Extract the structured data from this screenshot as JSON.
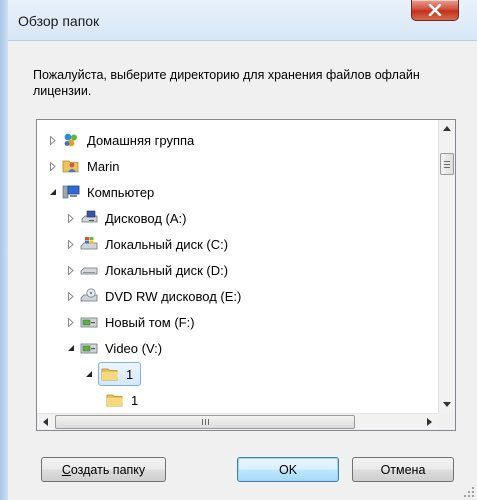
{
  "window": {
    "title": "Обзор папок",
    "instruction": "Пожалуйста, выберите директорию для хранения файлов офлайн лицензии."
  },
  "tree": {
    "items": [
      {
        "label": "Домашняя группа",
        "icon": "homegroup-icon",
        "expanded": false
      },
      {
        "label": "Marin",
        "icon": "user-folder-icon",
        "expanded": false
      },
      {
        "label": "Компьютер",
        "icon": "computer-icon",
        "expanded": true
      },
      {
        "label": "Дисковод (A:)",
        "icon": "floppy-drive-icon",
        "expanded": false
      },
      {
        "label": "Локальный диск (C:)",
        "icon": "system-drive-icon",
        "expanded": false
      },
      {
        "label": "Локальный диск (D:)",
        "icon": "hard-drive-icon",
        "expanded": false
      },
      {
        "label": "DVD RW дисковод (E:)",
        "icon": "dvd-drive-icon",
        "expanded": false
      },
      {
        "label": "Новый том (F:)",
        "icon": "removable-drive-icon",
        "expanded": false
      },
      {
        "label": "Video (V:)",
        "icon": "removable-drive-icon",
        "expanded": true
      },
      {
        "label": "1",
        "icon": "folder-icon",
        "expanded": true,
        "selected": true
      },
      {
        "label": "1",
        "icon": "folder-icon",
        "expanded": false
      }
    ]
  },
  "buttons": {
    "new_folder_prefix": "С",
    "new_folder_rest": "оздать папку",
    "ok": "OK",
    "cancel": "Отмена"
  },
  "colors": {
    "selection_border": "#7fb0e5",
    "close_button": "#c2311d",
    "default_button_border": "#3c7fb1"
  }
}
